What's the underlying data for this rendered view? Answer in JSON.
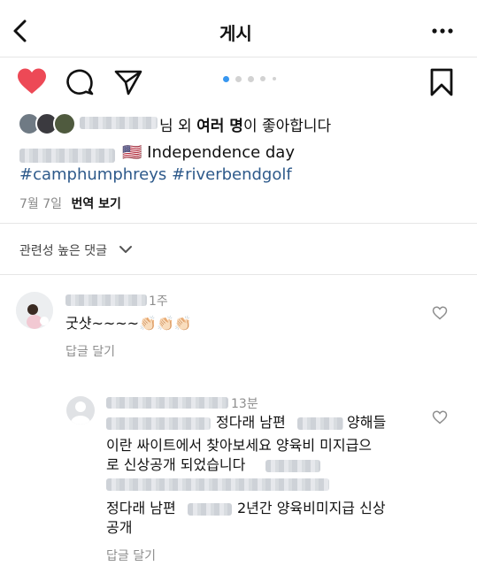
{
  "header": {
    "title": "게시"
  },
  "post": {
    "likes_text_suffix": "님 외",
    "likes_text_bold": "여러 명",
    "likes_text_end": "이 좋아합니다",
    "caption_text": "Independence day",
    "flag": "🇺🇸",
    "hashtags": "#camphumphreys #riverbendgolf",
    "date": "7월 7일",
    "translate": "번역 보기",
    "carousel_count": 5,
    "carousel_active_index": 0
  },
  "comments": {
    "sort_label": "관련성 높은 댓글",
    "items": [
      {
        "time": "1주",
        "text": "굿샷~~~~",
        "emoji": "👏🏻👏🏻👏🏻",
        "reply_label": "답글 달기"
      },
      {
        "time": "13분",
        "line1": "정다래 남편",
        "line1_end": "양해들",
        "line2": "이란 싸이트에서 찾아보세요 양육비 미지급으",
        "line3": "로 신상공개 되었습니다",
        "line5_start": "정다래 남편",
        "line5_end": "2년간 양육비미지급 신상",
        "line6": "공개",
        "reply_label": "답글 달기"
      }
    ]
  },
  "colors": {
    "like_red": "#ed4956",
    "hashtag_blue": "#2e5a8b",
    "dot_active": "#3897f0"
  }
}
